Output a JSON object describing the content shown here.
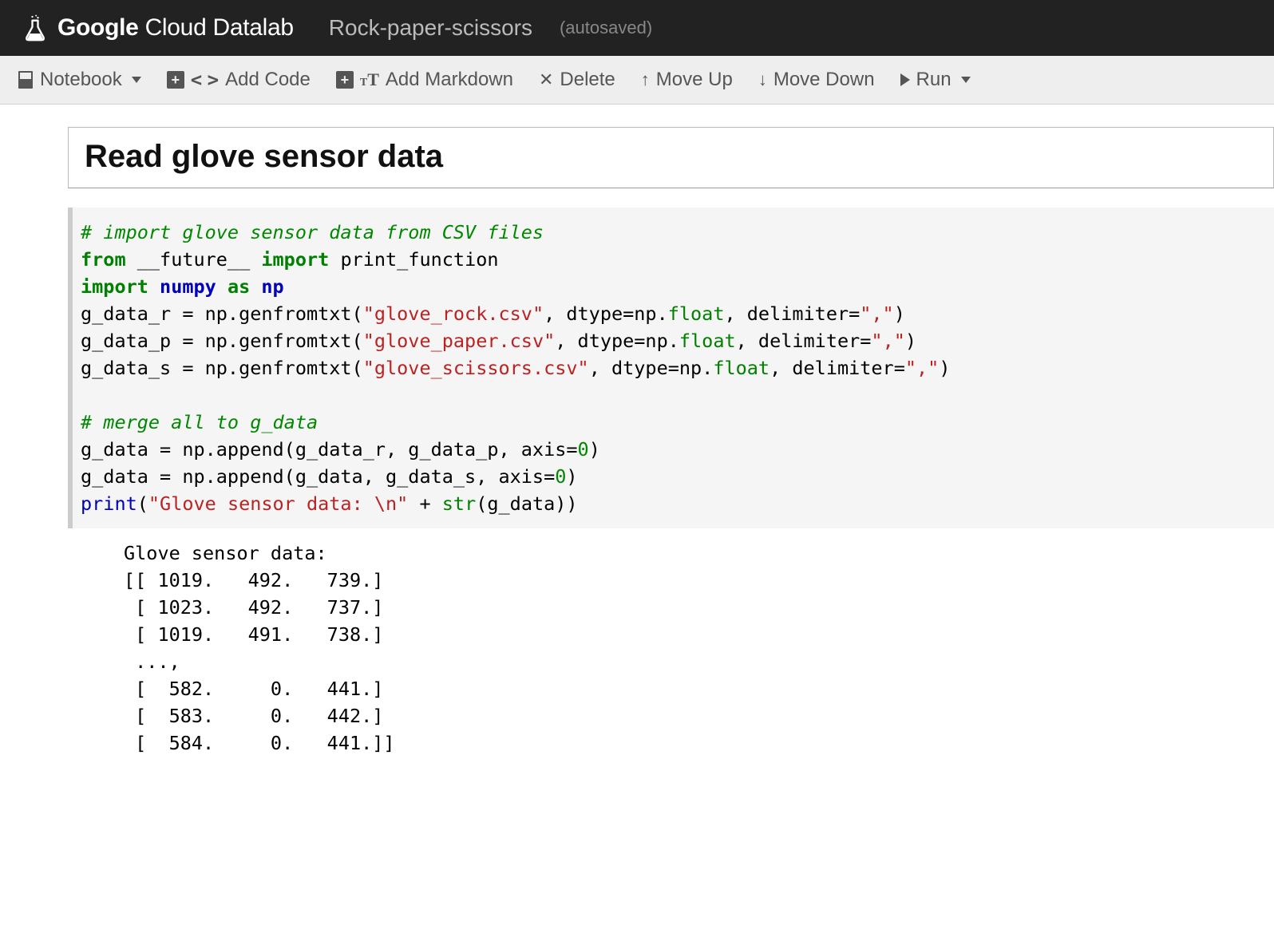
{
  "header": {
    "brand_google": "Google",
    "brand_rest": " Cloud Datalab",
    "notebook_title": "Rock-paper-scissors",
    "autosaved": "(autosaved)"
  },
  "toolbar": {
    "notebook": "Notebook",
    "add_code": "Add Code",
    "add_markdown": "Add Markdown",
    "delete": "Delete",
    "move_up": "Move Up",
    "move_down": "Move Down",
    "run": "Run"
  },
  "markdown": {
    "heading": "Read glove sensor data"
  },
  "code": {
    "c1": "# import glove sensor data from CSV files",
    "l2a": "from",
    "l2b": "__future__",
    "l2c": "import",
    "l2d": "print_function",
    "l3a": "import",
    "l3b": "numpy",
    "l3c": "as",
    "l3d": "np",
    "l4v": "g_data_r",
    "l4e": " = np.genfromtxt(",
    "l4s": "\"glove_rock.csv\"",
    "l4m": ", dtype=np.",
    "l4f": "float",
    "l4d": ", delimiter=",
    "l4q": "\",\"",
    "l4z": ")",
    "l5v": "g_data_p",
    "l5s": "\"glove_paper.csv\"",
    "l6v": "g_data_s",
    "l6s": "\"glove_scissors.csv\"",
    "c2": "# merge all to g_data",
    "l8": "g_data = np.append(g_data_r, g_data_p, axis=",
    "zro": "0",
    "l8z": ")",
    "l9": "g_data = np.append(g_data, g_data_s, axis=",
    "l10a": "print",
    "l10b": "(",
    "l10s": "\"Glove sensor data: \\n\"",
    "l10m": " + ",
    "l10f": "str",
    "l10g": "(g_data))"
  },
  "output": "Glove sensor data: \n[[ 1019.   492.   739.]\n [ 1023.   492.   737.]\n [ 1019.   491.   738.]\n ..., \n [  582.     0.   441.]\n [  583.     0.   442.]\n [  584.     0.   441.]]"
}
